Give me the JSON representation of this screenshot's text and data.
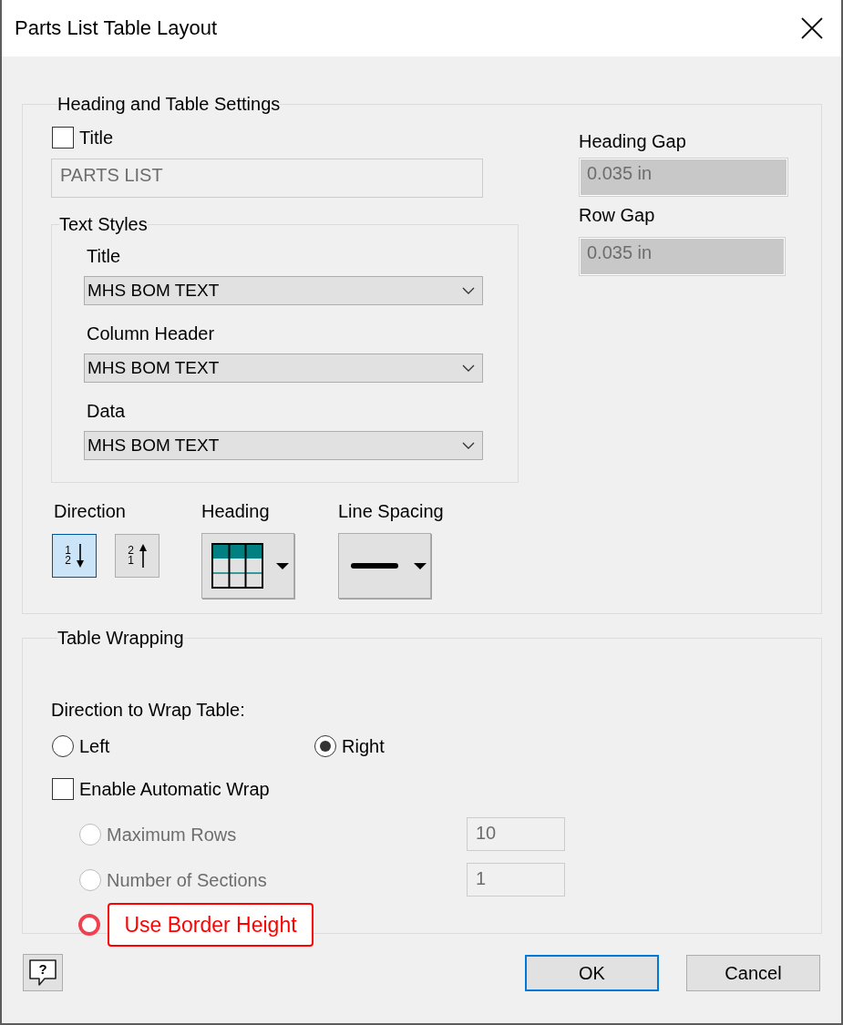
{
  "window": {
    "title": "Parts List Table Layout"
  },
  "heading_and_table_settings": {
    "legend": "Heading and Table Settings",
    "title_checkbox": {
      "label": "Title",
      "checked": false
    },
    "title_field": {
      "value": "PARTS LIST",
      "disabled": true
    },
    "text_styles": {
      "legend": "Text Styles",
      "dropdowns": [
        {
          "label": "Title",
          "value": "MHS BOM TEXT"
        },
        {
          "label": "Column Header",
          "value": "MHS BOM TEXT"
        },
        {
          "label": "Data",
          "value": "MHS BOM TEXT"
        }
      ]
    },
    "gap_fields": [
      {
        "label": "Heading Gap",
        "value": "0.035 in"
      },
      {
        "label": "Row Gap",
        "value": "0.035 in"
      }
    ],
    "direction": {
      "label": "Direction",
      "buttons": [
        {
          "kind": "descending",
          "digits": [
            "1",
            "2"
          ],
          "selected": true
        },
        {
          "kind": "ascending",
          "digits": [
            "2",
            "1"
          ],
          "selected": false
        }
      ]
    },
    "heading": {
      "label": "Heading"
    },
    "line_spacing": {
      "label": "Line Spacing"
    }
  },
  "table_wrapping": {
    "legend": "Table Wrapping",
    "direction_label": "Direction to Wrap Table:",
    "directions": [
      {
        "label": "Left",
        "selected": false
      },
      {
        "label": "Right",
        "selected": true
      }
    ],
    "automatic_wrap": {
      "label": "Enable Automatic Wrap",
      "checked": false
    },
    "wrap_options": [
      {
        "label": "Maximum Rows",
        "selected": false,
        "disabled": true,
        "highlighted": false,
        "value": "10"
      },
      {
        "label": "Number of Sections",
        "selected": false,
        "disabled": true,
        "highlighted": false,
        "value": "1"
      },
      {
        "label": "Use Border Height",
        "selected": false,
        "disabled": true,
        "highlighted": true
      }
    ]
  },
  "footer": {
    "help_symbol": "?",
    "buttons": [
      {
        "label": "OK",
        "default": true
      },
      {
        "label": "Cancel",
        "default": false
      }
    ]
  }
}
